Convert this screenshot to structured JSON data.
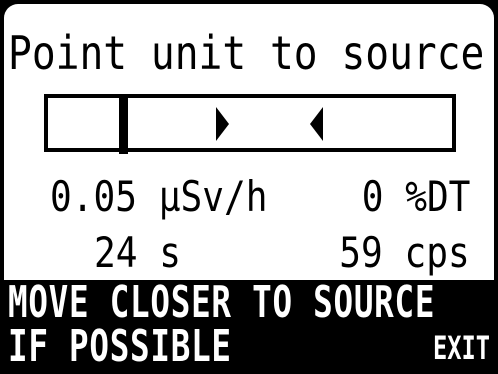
{
  "instruction": "Point unit to source",
  "indicator": {
    "position_fraction": 0.18,
    "target_arrows": [
      "right-arrow-icon",
      "left-arrow-icon"
    ]
  },
  "readings": {
    "dose_rate": "0.05 µSv/h",
    "dead_time": "0 %DT",
    "elapsed": "24 s",
    "count_rate": "59 cps"
  },
  "message": {
    "line1": "MOVE CLOSER TO SOURCE",
    "line2": "IF POSSIBLE"
  },
  "softkey": {
    "exit_label": "EXIT"
  }
}
